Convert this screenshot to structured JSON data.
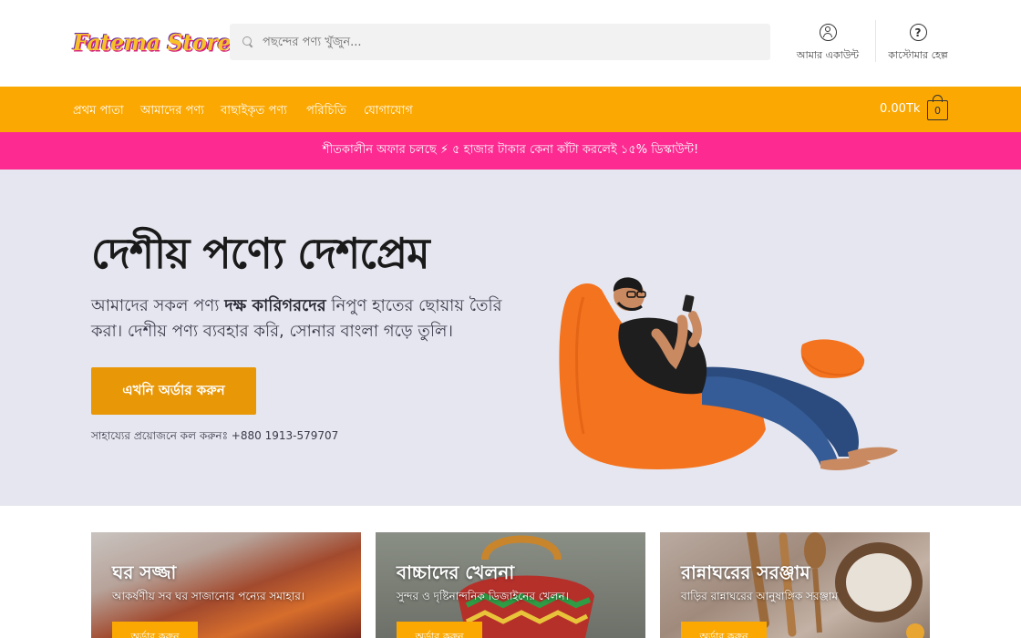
{
  "header": {
    "logo_text": "Fatema Store",
    "search_placeholder": "পছন্দের পণ্য খুঁজুন...",
    "account_label": "আমার একাউন্ট",
    "help_label": "কাস্টোমার হেল্প",
    "help_icon_glyph": "?"
  },
  "nav": {
    "items": [
      {
        "label": "প্রথম পাতা"
      },
      {
        "label": "আমাদের পণ্য"
      },
      {
        "label": "বাছাইকৃত পণ্য"
      },
      {
        "label": "পরিচিতি"
      },
      {
        "label": "যোগাযোগ"
      }
    ],
    "cart_total": "0.00Tk",
    "cart_count": "0"
  },
  "promo": {
    "text": "শীতকালীন অফার চলছে ⚡ ৫ হাজার টাকার কেনা কাঁটা করলেই ১৫% ডিস্কাউন্ট!"
  },
  "hero": {
    "title": "দেশীয় পণ্যে দেশপ্রেম",
    "desc_part1": "আমাদের সকল পণ্য ",
    "desc_bold": "দক্ষ কারিগরদের",
    "desc_part2": " নিপুণ হাতের ছোয়ায় তৈরি করা। দেশীয় পণ্য ব্যবহার করি, সোনার বাংলা গড়ে তুলি।",
    "cta_label": "এখনি অর্ডার করুন",
    "help_line": "সাহায্যের প্রয়োজনে কল করুনঃ +880 1913-579707"
  },
  "categories": [
    {
      "title": "ঘর সজ্জা",
      "subtitle": "আকর্ষণীয় সব ঘর সাজানোর পন্যের সমাহার।",
      "button": "অর্ডার করুন"
    },
    {
      "title": "বাচ্চাদের খেলনা",
      "subtitle": "সুন্দর ও দৃষ্টিনান্দনিক ডিজাইনের খেলন।",
      "button": "অর্ডার করুন"
    },
    {
      "title": "রান্নাঘরের সরঞ্জাম",
      "subtitle": "বাড়ির রান্নাঘরের আনুষাঙ্গিক সরঞ্জাম",
      "button": "অর্ডার করুন"
    }
  ],
  "colors": {
    "nav_bg": "#fba802",
    "promo_bg": "#fc2a91",
    "hero_bg": "#e5e6ef",
    "cta_bg": "#e89707"
  }
}
